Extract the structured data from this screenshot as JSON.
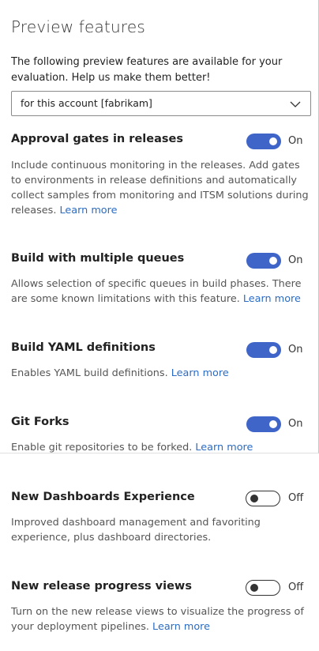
{
  "page": {
    "title": "Preview features",
    "intro": "The following preview features are available for your evaluation. Help us make them better!"
  },
  "scope_dropdown": {
    "selected": "for this account [fabrikam]",
    "icon": "chevron-down-icon"
  },
  "features": [
    {
      "name": "Approval gates in releases",
      "description": "Include continuous monitoring in the releases. Add gates to environments in release definitions and automatically collect samples from monitoring and ITSM solutions during releases.",
      "link": "Learn more",
      "enabled": true,
      "state_label": "On"
    },
    {
      "name": "Build with multiple queues",
      "description": "Allows selection of specific queues in build phases. There are some known limitations with this feature.",
      "link": "Learn more",
      "enabled": true,
      "state_label": "On"
    },
    {
      "name": "Build YAML definitions",
      "description": "Enables YAML build definitions.",
      "link": "Learn more",
      "enabled": true,
      "state_label": "On"
    },
    {
      "name": "Git Forks",
      "description": "Enable git repositories to be forked.",
      "link": "Learn more",
      "enabled": true,
      "state_label": "On"
    },
    {
      "name": "New Dashboards Experience",
      "description": "Improved dashboard management and favoriting experience, plus dashboard directories.",
      "link": "",
      "enabled": false,
      "state_label": "Off"
    },
    {
      "name": "New release progress views",
      "description": "Turn on the new release views to visualize the progress of your deployment pipelines.",
      "link": "Learn more",
      "enabled": false,
      "state_label": "Off"
    }
  ],
  "colors": {
    "toggle_on": "#3f65c8",
    "link": "#2b6cc4"
  }
}
